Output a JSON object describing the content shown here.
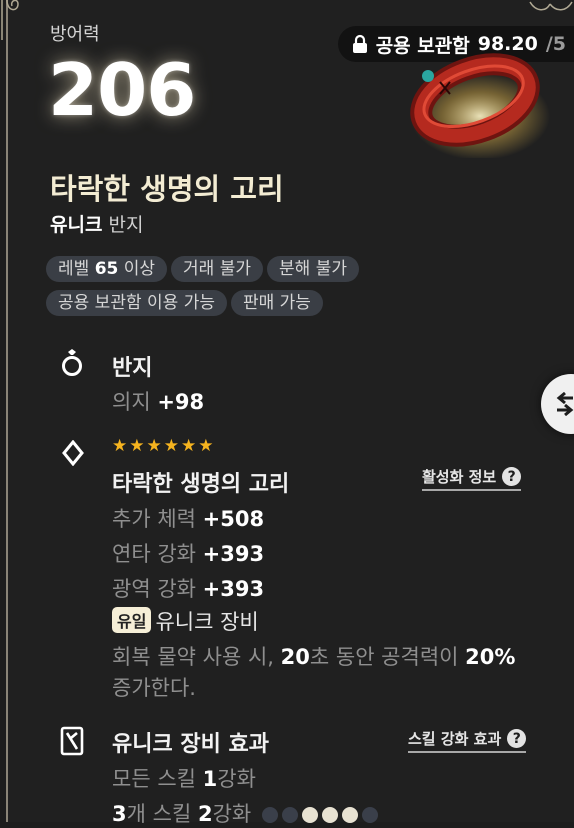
{
  "defense": {
    "label": "방어력",
    "value": "206"
  },
  "storage": {
    "label": "공용 보관함",
    "count": "98.20",
    "max": "/5"
  },
  "item": {
    "name": "타락한 생명의 고리",
    "rarity": "유니크",
    "type": "반지"
  },
  "tags": {
    "level_prefix": "레벨",
    "level_value": "65",
    "level_suffix": "이상",
    "trade": "거래 불가",
    "dismantle": "분해 불가",
    "storage_use": "공용 보관함 이용 가능",
    "sell": "판매 가능"
  },
  "base_stat": {
    "title": "반지",
    "stat_name": "의지",
    "stat_value": "+98"
  },
  "set_effect": {
    "stars": 6,
    "title": "타락한 생명의 고리",
    "info_link": "활성화 정보",
    "stats": [
      {
        "name": "추가 체력",
        "value": "+508"
      },
      {
        "name": "연타 강화",
        "value": "+393"
      },
      {
        "name": "광역 강화",
        "value": "+393"
      }
    ],
    "unique_badge": "유일",
    "unique_text": "유니크 장비",
    "desc_1": "회복 물약 사용 시,",
    "desc_2": "20",
    "desc_3": "초 동안 공격력이",
    "desc_4": "20%",
    "desc_5": "증가한다."
  },
  "unique_effect": {
    "title": "유니크 장비 효과",
    "skill_link": "스킬 강화 효과",
    "line1_prefix": "모든 스킬",
    "line1_value": "1",
    "line1_suffix": "강화",
    "line2_count": "3",
    "line2_mid": "개 스킬",
    "line2_value": "2",
    "line2_suffix": "강화",
    "dots_total": 6,
    "dots_filled": 3
  },
  "colors": {
    "accent_gold": "#f6b41f",
    "badge_bg": "#f6efd7",
    "tag_bg": "#3a3e45",
    "dot_on": "#e8e2d2",
    "dot_off": "#3a3f4a"
  },
  "icons": [
    "lock-icon",
    "ring-icon",
    "diamond-icon",
    "unique-card-icon",
    "question-icon",
    "back-arrow-icon"
  ]
}
